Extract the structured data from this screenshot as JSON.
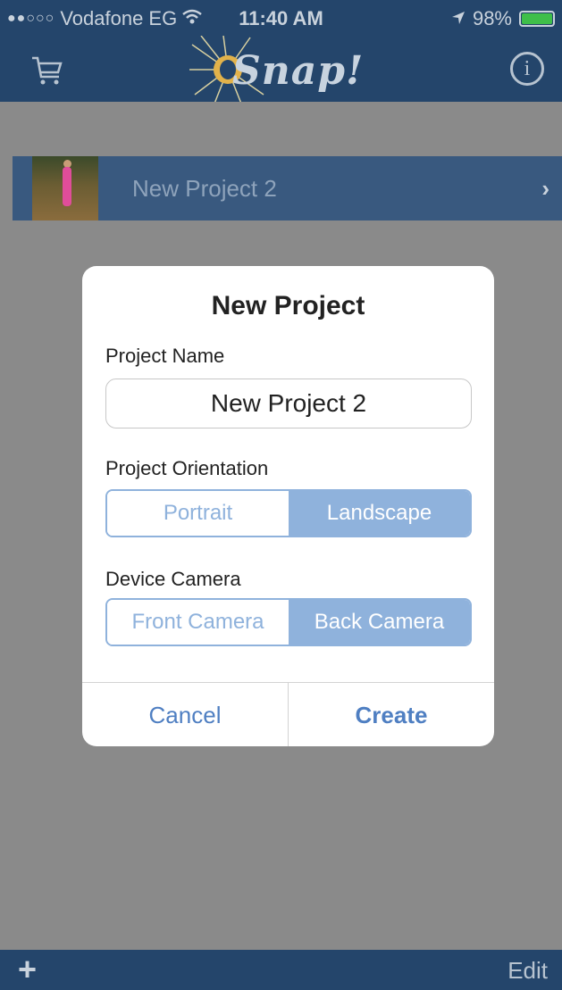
{
  "status_bar": {
    "carrier": "Vodafone EG",
    "time": "11:40 AM",
    "battery": "98%",
    "battery_level": 0.98
  },
  "nav": {
    "logo_text": "Snap!"
  },
  "list": {
    "rows": [
      {
        "title": "New Project 2"
      }
    ]
  },
  "modal": {
    "title": "New Project",
    "project_name_label": "Project Name",
    "project_name_value": "New Project 2",
    "orientation_label": "Project Orientation",
    "orientation_options": [
      "Portrait",
      "Landscape"
    ],
    "orientation_selected": "Landscape",
    "camera_label": "Device Camera",
    "camera_options": [
      "Front Camera",
      "Back Camera"
    ],
    "camera_selected": "Back Camera",
    "cancel_label": "Cancel",
    "create_label": "Create"
  },
  "toolbar": {
    "add_icon": "+",
    "edit_label": "Edit"
  },
  "colors": {
    "nav_background": "#24456b",
    "accent": "#8fb2dc",
    "action_text": "#4f7fc2"
  }
}
